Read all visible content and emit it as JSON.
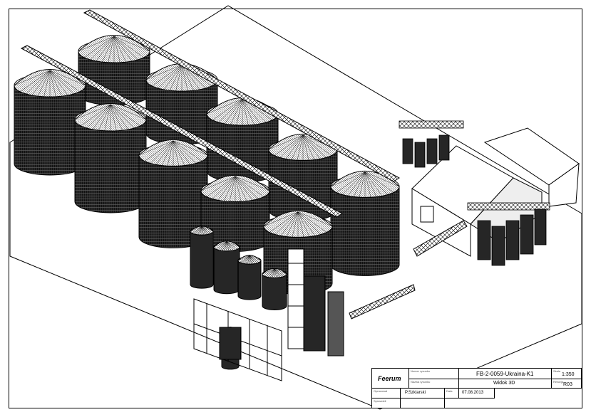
{
  "title_block": {
    "logo_text": "Feerum",
    "drawing_number": "FB-2-0059-Ukraina-K1",
    "view_name": "Widok 3D",
    "scale": "1:350",
    "revision": "R03",
    "author": "P.Szklarski",
    "date": "07.08.2013",
    "field_labels": {
      "drawing_no": "Numer rysunku",
      "view": "Nazwa rysunku",
      "scale": "Skala",
      "revision": "Rewizja",
      "drawn": "Opracował",
      "checked": "Sprawdził",
      "date": "Data"
    }
  },
  "drawing": {
    "subject": "isometric grain silo complex",
    "line_color": "#000000",
    "background": "#ffffff"
  }
}
